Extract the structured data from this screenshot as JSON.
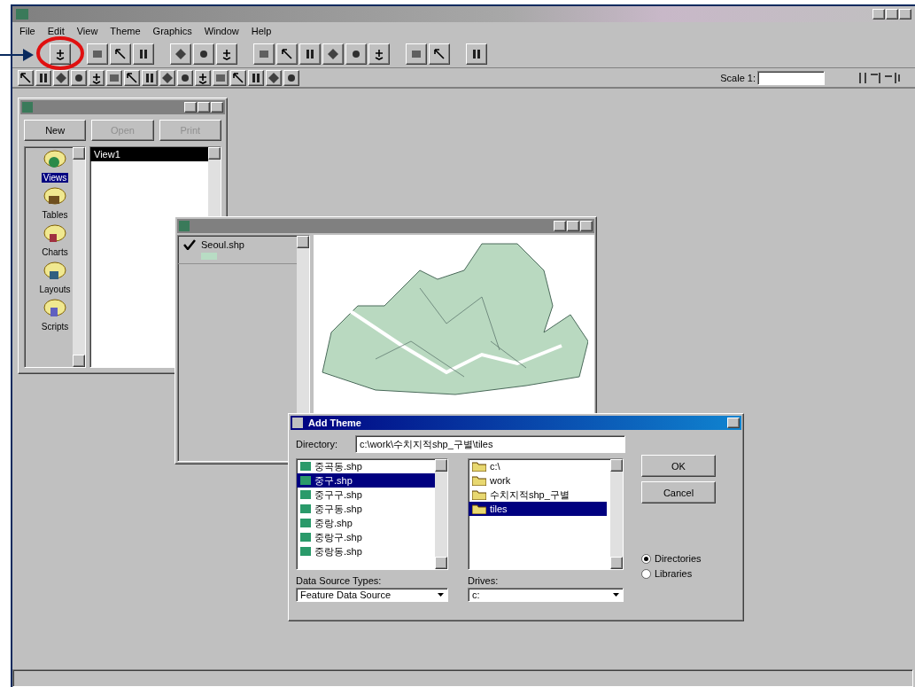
{
  "menu": [
    "File",
    "Edit",
    "View",
    "Theme",
    "Graphics",
    "Window",
    "Help"
  ],
  "scale": {
    "label": "Scale 1:"
  },
  "project_window": {
    "buttons": [
      {
        "label": "New",
        "disabled": false
      },
      {
        "label": "Open",
        "disabled": true
      },
      {
        "label": "Print",
        "disabled": true
      }
    ],
    "doc_types": [
      {
        "label": "Views",
        "selected": true,
        "kind": "views"
      },
      {
        "label": "Tables",
        "selected": false,
        "kind": "tables"
      },
      {
        "label": "Charts",
        "selected": false,
        "kind": "charts"
      },
      {
        "label": "Layouts",
        "selected": false,
        "kind": "layouts"
      },
      {
        "label": "Scripts",
        "selected": false,
        "kind": "scripts"
      }
    ],
    "documents": [
      {
        "label": "View1",
        "selected": true
      }
    ]
  },
  "view_window": {
    "themes": [
      {
        "label": "Seoul.shp",
        "checked": true
      }
    ]
  },
  "add_theme_dialog": {
    "title": "Add Theme",
    "directory_label": "Directory:",
    "directory": "c:\\work\\수치지적shp_구별\\tiles",
    "files": [
      {
        "label": "중곡동.shp",
        "selected": false
      },
      {
        "label": "중구.shp",
        "selected": true
      },
      {
        "label": "중구구.shp",
        "selected": false
      },
      {
        "label": "중구동.shp",
        "selected": false
      },
      {
        "label": "중랑.shp",
        "selected": false
      },
      {
        "label": "중랑구.shp",
        "selected": false
      },
      {
        "label": "중랑동.shp",
        "selected": false
      }
    ],
    "folders": [
      {
        "label": "c:\\",
        "selected": false
      },
      {
        "label": "work",
        "selected": false
      },
      {
        "label": "수치지적shp_구별",
        "selected": false
      },
      {
        "label": "tiles",
        "selected": true
      }
    ],
    "buttons": [
      "OK",
      "Cancel"
    ],
    "options": [
      {
        "label": "Directories",
        "selected": true
      },
      {
        "label": "Libraries",
        "selected": false
      }
    ],
    "source_types_label": "Data Source Types:",
    "source_type": "Feature Data Source",
    "drives_label": "Drives:",
    "drive": "c:"
  }
}
